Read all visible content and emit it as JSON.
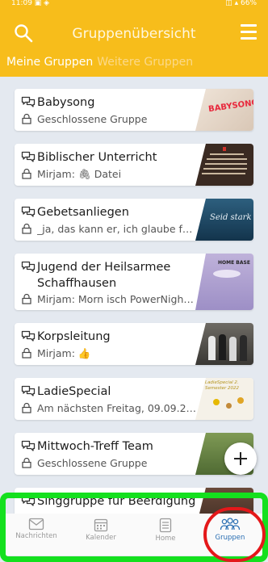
{
  "status": {
    "left": "11:09 ▣ ◈",
    "right": "◫ ▴ 66%"
  },
  "header": {
    "title": "Gruppenübersicht"
  },
  "tabs": [
    {
      "label": "Meine Gruppen"
    },
    {
      "label": "Weitere Gruppen"
    }
  ],
  "groups": [
    {
      "name": "Babysong",
      "subtitle": "Geschlossene Gruppe"
    },
    {
      "name": "Biblischer Unterricht",
      "subtitle": "Mirjam: 🖇 Datei"
    },
    {
      "name": "Gebetsanliegen",
      "subtitle": "_ja, das kann er, ich glaube fes…"
    },
    {
      "name": "Jugend der Heilsarmee Schaffhausen",
      "subtitle": "Mirjam: Morn isch PowerNight …"
    },
    {
      "name": "Korpsleitung",
      "subtitle": "Mirjam: 👍"
    },
    {
      "name": "LadieSpecial",
      "subtitle": "Am nächsten Freitag, 09.09.20…"
    },
    {
      "name": "Mittwoch-Treff Team",
      "subtitle": "Geschlossene Gruppe"
    },
    {
      "name": "Singgruppe für Beerdigung",
      "subtitle": ""
    }
  ],
  "thumbs": {
    "babysong": "BABYSONG",
    "gebet": "Seid stark",
    "jugend": "HOME BASE",
    "ladies": "LadieSpecial 2. Semester 2022"
  },
  "nav": [
    {
      "label": "Nachrichten"
    },
    {
      "label": "Kalender"
    },
    {
      "label": "Home"
    },
    {
      "label": "Gruppen"
    }
  ],
  "colors": {
    "accent": "#f7bd1b",
    "active_nav": "#2a6fb3",
    "highlight_green": "#14e01e",
    "highlight_red": "#e4181a"
  }
}
